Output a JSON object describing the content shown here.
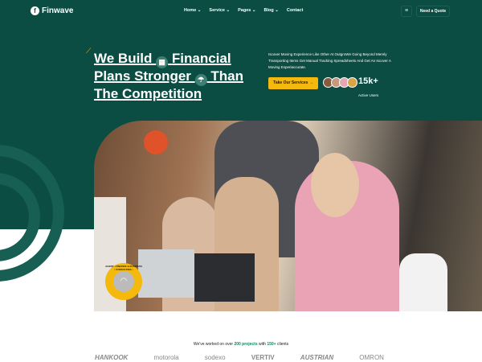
{
  "nav": {
    "brand": "Finwave",
    "items": [
      {
        "label": "Home ⌄"
      },
      {
        "label": "Service ⌄"
      },
      {
        "label": "Pages ⌄"
      },
      {
        "label": "Blog ⌄"
      },
      {
        "label": "Contact"
      }
    ],
    "quote": "Need a Quote",
    "menu_icon": "hamburger-icon"
  },
  "hero": {
    "title_1": "We Build",
    "title_2": "Financial",
    "title_3": "Plans Stronger",
    "title_4": "Than",
    "title_5": "The Competition",
    "description": "Iscover Moving Experience Like Other At OutgroWe Going Beyond Merely Transporting Items Get Manual Tracking Spreadsheets And Get An Iscover A Moving Experiaccurate.",
    "cta": "Take Our Services",
    "stat_value": "15k+",
    "stat_label": "Active Users"
  },
  "badge": {
    "text": "AGENT • FINANCE & BUSINESS • CONSULTING •"
  },
  "clients": {
    "prefix": "We've worked on over",
    "projects": "200 projects",
    "mid": "with",
    "count": "150+",
    "suffix": "clients",
    "logos": [
      "HANKOOK",
      "motorola",
      "sodexo",
      "VERTIV",
      "AUSTRIAN",
      "OMRON"
    ]
  },
  "colors": {
    "primary": "#0b4d43",
    "accent": "#f5b80c"
  }
}
